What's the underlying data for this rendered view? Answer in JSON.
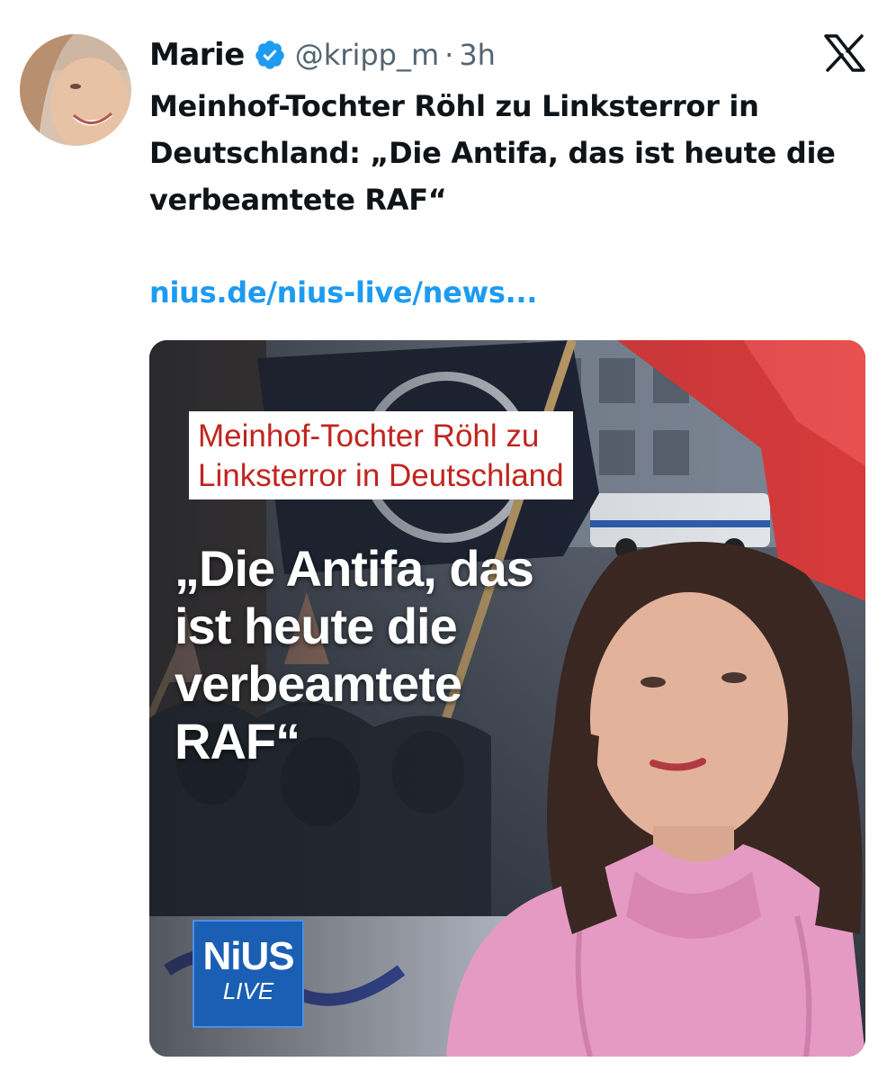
{
  "author": {
    "name": "Marie",
    "verified_icon": "verified-badge-icon",
    "handle": "@kripp_m",
    "separator": "·",
    "time": "3h"
  },
  "platform_icon": "x-logo-icon",
  "tweet": {
    "text": "Meinhof-Tochter Röhl zu Linksterror in Deutschland: „Die Antifa, das ist heute die verbeamtete RAF“",
    "link": "nius.de/nius-live/news..."
  },
  "card": {
    "headline": "Meinhof-Tochter Röhl zu\nLinksterror in Deutschland",
    "quote": "„Die Antifa, das\nist heute die\nverbeamtete\nRAF“",
    "brand_main": "NiUS",
    "brand_sub": "LIVE"
  },
  "colors": {
    "text": "#0f1419",
    "secondary": "#536471",
    "link": "#1d9bf0",
    "verified": "#1d9bf0",
    "headline_red": "#c0251e",
    "brand_blue": "#1a5fb4",
    "sweater_pink": "#e59ac4"
  }
}
